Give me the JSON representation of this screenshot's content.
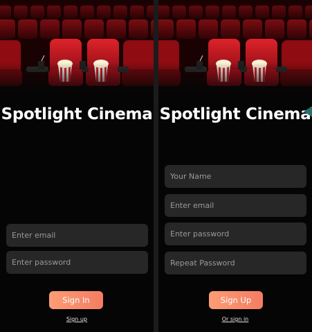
{
  "app": {
    "title": "Spotlight Cinema"
  },
  "login_screen": {
    "email_placeholder": "Enter email",
    "password_placeholder": "Enter password",
    "sign_in_label": "Sign In",
    "sign_up_link": "Sign up"
  },
  "signup_screen": {
    "name_placeholder": "Your Name",
    "email_placeholder": "Enter email",
    "password_placeholder": "Enter password",
    "repeat_password_placeholder": "Repeat Password",
    "sign_up_label": "Sign Up",
    "sign_in_link": "Or sign in"
  },
  "colors": {
    "background": "#050505",
    "field_background": "#272727",
    "accent_start": "#fb9d75",
    "accent_end": "#f47d63",
    "seat_red": "#c8141c"
  },
  "icons": {
    "hero": "cinema-seats-popcorn-image"
  }
}
